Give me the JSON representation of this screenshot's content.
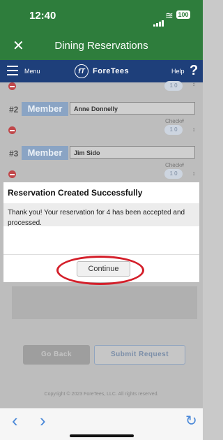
{
  "status": {
    "time": "12:40",
    "battery": "100"
  },
  "nav": {
    "close_icon": "close-icon",
    "title": "Dining Reservations"
  },
  "app": {
    "menu_label": "Menu",
    "logo_mark": "fT",
    "logo_text": "ForeTees",
    "help_label": "Help",
    "help_mark": "?"
  },
  "partial_row": {
    "stepper": "1 0",
    "arrow": "↕"
  },
  "rows": [
    {
      "num": "#2",
      "type": "Member",
      "name": "Anne Donnelly",
      "check_label": "Check#",
      "stepper": "1 0",
      "arrow": "↕"
    },
    {
      "num": "#3",
      "type": "Member",
      "name": "Jim Sido",
      "check_label": "Check#",
      "stepper": "1 0",
      "arrow": "↕"
    }
  ],
  "dialog": {
    "title": "Reservation Created Successfully",
    "message": "Thank you! Your reservation for 4 has been accepted and processed.",
    "button": "Continue"
  },
  "actions": {
    "go_back": "Go Back",
    "submit": "Submit Request"
  },
  "footer": {
    "copyright": "Copyright © 2023 ForeTees, LLC. All rights reserved."
  },
  "browser": {
    "back": "‹",
    "forward": "›",
    "reload": "↻"
  },
  "colors": {
    "header_green": "#2e7d3c",
    "brand_blue": "#1e3f7a",
    "highlight_red": "#d41f2a",
    "link_blue": "#4a88d8"
  }
}
